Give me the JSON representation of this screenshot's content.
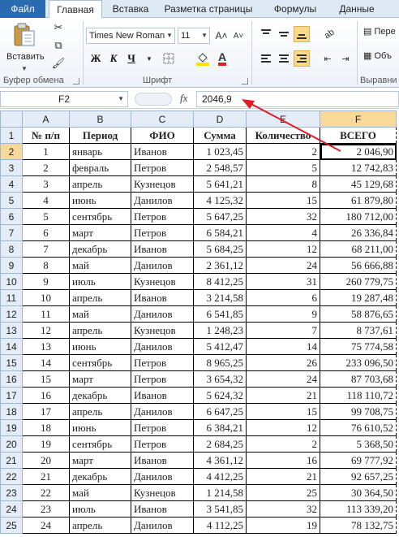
{
  "tabs": {
    "file": "Файл",
    "items": [
      "Главная",
      "Вставка",
      "Разметка страницы",
      "Формулы",
      "Данные"
    ]
  },
  "ribbon": {
    "clipboard": {
      "paste_label": "Вставить",
      "group_label": "Буфер обмена"
    },
    "font": {
      "font_name": "Times New Roman",
      "font_size": "11",
      "bold": "Ж",
      "italic": "К",
      "underline": "Ч",
      "font_color_glyph": "A",
      "group_label": "Шрифт",
      "highlight_color": "#f5e400",
      "font_color": "#e02020"
    },
    "alignment": {
      "group_label": "Выравни",
      "wrap_label": "Пере",
      "merge_label": "Объ"
    }
  },
  "formula_bar": {
    "name_box": "F2",
    "fx": "fx",
    "value": "2046,9"
  },
  "grid": {
    "columns": [
      "A",
      "B",
      "C",
      "D",
      "E",
      "F"
    ],
    "selected_column": "F",
    "selected_row": "2",
    "header_row": [
      "№ п/п",
      "Период",
      "ФИО",
      "Сумма",
      "Количество",
      "ВСЕГО"
    ],
    "rows": [
      {
        "n": "2",
        "cells": [
          "1",
          "январь",
          "Иванов",
          "1 023,45",
          "2",
          "2 046,90"
        ]
      },
      {
        "n": "3",
        "cells": [
          "2",
          "февраль",
          "Петров",
          "2 548,57",
          "5",
          "12 742,83"
        ]
      },
      {
        "n": "4",
        "cells": [
          "3",
          "апрель",
          "Кузнецов",
          "5 641,21",
          "8",
          "45 129,68"
        ]
      },
      {
        "n": "5",
        "cells": [
          "4",
          "июнь",
          "Данилов",
          "4 125,32",
          "15",
          "61 879,80"
        ]
      },
      {
        "n": "6",
        "cells": [
          "5",
          "сентябрь",
          "Петров",
          "5 647,25",
          "32",
          "180 712,00"
        ]
      },
      {
        "n": "7",
        "cells": [
          "6",
          "март",
          "Петров",
          "6 584,21",
          "4",
          "26 336,84"
        ]
      },
      {
        "n": "8",
        "cells": [
          "7",
          "декабрь",
          "Иванов",
          "5 684,25",
          "12",
          "68 211,00"
        ]
      },
      {
        "n": "9",
        "cells": [
          "8",
          "май",
          "Данилов",
          "2 361,12",
          "24",
          "56 666,88"
        ]
      },
      {
        "n": "10",
        "cells": [
          "9",
          "июль",
          "Кузнецов",
          "8 412,25",
          "31",
          "260 779,75"
        ]
      },
      {
        "n": "11",
        "cells": [
          "10",
          "апрель",
          "Иванов",
          "3 214,58",
          "6",
          "19 287,48"
        ]
      },
      {
        "n": "12",
        "cells": [
          "11",
          "май",
          "Данилов",
          "6 541,85",
          "9",
          "58 876,65"
        ]
      },
      {
        "n": "13",
        "cells": [
          "12",
          "апрель",
          "Кузнецов",
          "1 248,23",
          "7",
          "8 737,61"
        ]
      },
      {
        "n": "14",
        "cells": [
          "13",
          "июнь",
          "Данилов",
          "5 412,47",
          "14",
          "75 774,58"
        ]
      },
      {
        "n": "15",
        "cells": [
          "14",
          "сентябрь",
          "Петров",
          "8 965,25",
          "26",
          "233 096,50"
        ]
      },
      {
        "n": "16",
        "cells": [
          "15",
          "март",
          "Петров",
          "3 654,32",
          "24",
          "87 703,68"
        ]
      },
      {
        "n": "17",
        "cells": [
          "16",
          "декабрь",
          "Иванов",
          "5 624,32",
          "21",
          "118 110,72"
        ]
      },
      {
        "n": "18",
        "cells": [
          "17",
          "апрель",
          "Данилов",
          "6 647,25",
          "15",
          "99 708,75"
        ]
      },
      {
        "n": "19",
        "cells": [
          "18",
          "июнь",
          "Петров",
          "6 384,21",
          "12",
          "76 610,52"
        ]
      },
      {
        "n": "20",
        "cells": [
          "19",
          "сентябрь",
          "Петров",
          "2 684,25",
          "2",
          "5 368,50"
        ]
      },
      {
        "n": "21",
        "cells": [
          "20",
          "март",
          "Иванов",
          "4 361,12",
          "16",
          "69 777,92"
        ]
      },
      {
        "n": "22",
        "cells": [
          "21",
          "декабрь",
          "Данилов",
          "4 412,25",
          "21",
          "92 657,25"
        ]
      },
      {
        "n": "23",
        "cells": [
          "22",
          "май",
          "Кузнецов",
          "1 214,58",
          "25",
          "30 364,50"
        ]
      },
      {
        "n": "24",
        "cells": [
          "23",
          "июль",
          "Иванов",
          "3 541,85",
          "32",
          "113 339,20"
        ]
      },
      {
        "n": "25",
        "cells": [
          "24",
          "апрель",
          "Данилов",
          "4 112,25",
          "19",
          "78 132,75"
        ]
      }
    ]
  },
  "annotation": {
    "arrow_color": "#e01b24"
  }
}
